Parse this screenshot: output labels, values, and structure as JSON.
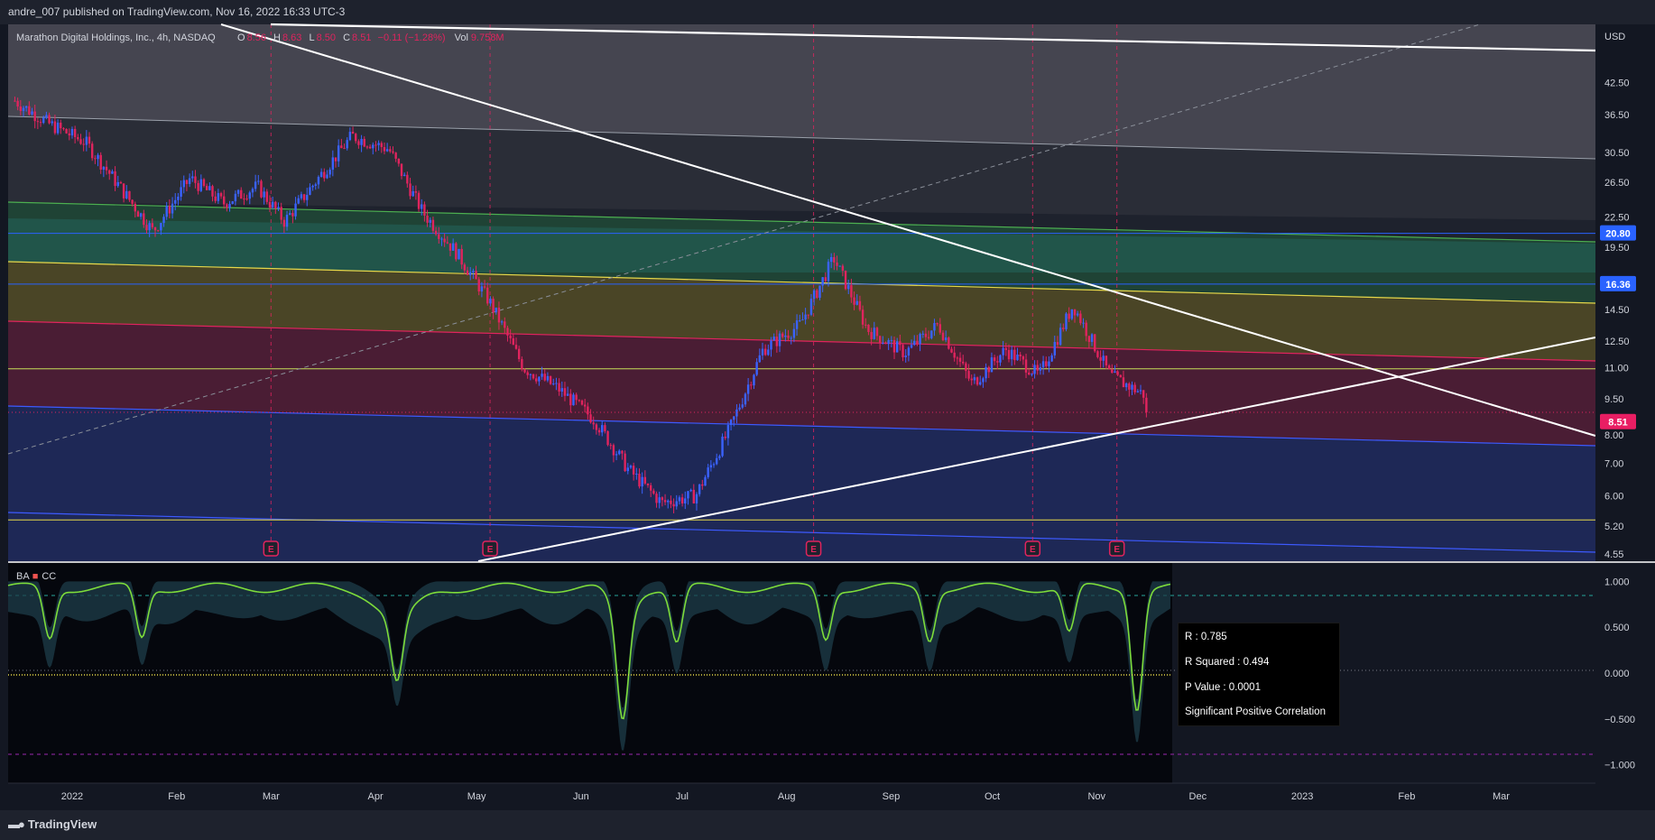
{
  "header": {
    "published": "andre_007 published on TradingView.com, Nov 16, 2022 16:33 UTC-3"
  },
  "footer": {
    "logo_text": "TradingView"
  },
  "main_chart": {
    "symbol": "Marathon Digital Holdings, Inc., 4h, NASDAQ",
    "ohlc": {
      "o_label": "O",
      "o": "8.56",
      "h_label": "H",
      "h": "8.63",
      "l_label": "L",
      "l": "8.50",
      "c_label": "C",
      "c": "8.51",
      "change": "−0.11 (−1.28%)",
      "vol_label": "Vol",
      "vol": "9.758M"
    },
    "currency": "USD",
    "price_labels": [
      "42.50",
      "36.50",
      "30.50",
      "26.50",
      "22.50",
      "19.50",
      "14.50",
      "12.50",
      "11.00",
      "9.50",
      "8.00",
      "7.00",
      "6.00",
      "5.20",
      "4.55"
    ],
    "badges": [
      {
        "text": "20.80",
        "color": "#2962ff"
      },
      {
        "text": "16.36",
        "color": "#2962ff"
      },
      {
        "text": "8.51",
        "color": "#e91e63"
      }
    ],
    "earnings_marker": "E",
    "colors": {
      "up": "#3a62ff",
      "down": "#e0245e"
    }
  },
  "indicator": {
    "name": "BA",
    "name2": "CC",
    "levels": [
      "1.000",
      "0.500",
      "0.000",
      "−0.500",
      "−1.000"
    ],
    "stats": {
      "r": "R : 0.785",
      "r_squared": "R Squared : 0.494",
      "p_value": "P Value : 0.0001",
      "conclusion": "Significant Positive Correlation"
    }
  },
  "time_axis": [
    "2022",
    "Feb",
    "Mar",
    "Apr",
    "May",
    "Jun",
    "Jul",
    "Aug",
    "Sep",
    "Oct",
    "Nov",
    "Dec",
    "2023",
    "Feb",
    "Mar"
  ],
  "chart_data": [
    {
      "type": "candlestick",
      "title": "Marathon Digital Holdings, Inc., 4h, NASDAQ",
      "ylabel": "USD",
      "scale": "log",
      "ylim": [
        4.4,
        56
      ],
      "x_ticks": [
        "2022",
        "Feb",
        "Mar",
        "Apr",
        "May",
        "Jun",
        "Jul",
        "Aug",
        "Sep",
        "Oct",
        "Nov",
        "Dec",
        "2023",
        "Feb",
        "Mar"
      ],
      "x_range": [
        "2021-12-13",
        "2023-03-29"
      ],
      "close_series": {
        "dates": [
          "2021-12-15",
          "2021-12-25",
          "2022-01-05",
          "2022-01-15",
          "2022-01-25",
          "2022-02-05",
          "2022-02-15",
          "2022-02-25",
          "2022-03-05",
          "2022-03-15",
          "2022-03-25",
          "2022-04-05",
          "2022-04-15",
          "2022-04-25",
          "2022-05-05",
          "2022-05-15",
          "2022-05-25",
          "2022-06-05",
          "2022-06-15",
          "2022-06-25",
          "2022-07-05",
          "2022-07-15",
          "2022-07-25",
          "2022-08-05",
          "2022-08-15",
          "2022-08-25",
          "2022-09-05",
          "2022-09-15",
          "2022-09-25",
          "2022-10-05",
          "2022-10-15",
          "2022-10-25",
          "2022-11-05",
          "2022-11-15",
          "2022-11-16"
        ],
        "close": [
          39,
          35,
          32,
          26,
          21,
          27,
          24,
          26,
          22,
          27,
          33,
          31,
          23,
          19,
          15,
          11,
          10,
          8.6,
          6.8,
          5.8,
          6.0,
          8.2,
          12,
          13.5,
          18.5,
          13.2,
          11.8,
          13.5,
          10.2,
          12.0,
          10.6,
          14.8,
          10.6,
          9.7,
          8.51
        ]
      },
      "last_price": 8.51,
      "volume": "9.758M",
      "horizontal_levels": [
        20.8,
        16.36,
        10.95,
        5.35
      ],
      "earnings_dates": [
        "2022-03-01",
        "2022-05-05",
        "2022-08-09",
        "2022-10-13",
        "2022-11-07"
      ]
    },
    {
      "type": "line",
      "title": "BA CC",
      "ylim": [
        -1.2,
        1.2
      ],
      "y_ticks": [
        1.0,
        0.5,
        0.0,
        -0.5,
        -1.0
      ],
      "stats": {
        "R": 0.785,
        "R Squared": 0.494,
        "P Value": 0.0001,
        "conclusion": "Significant Positive Correlation"
      }
    }
  ]
}
